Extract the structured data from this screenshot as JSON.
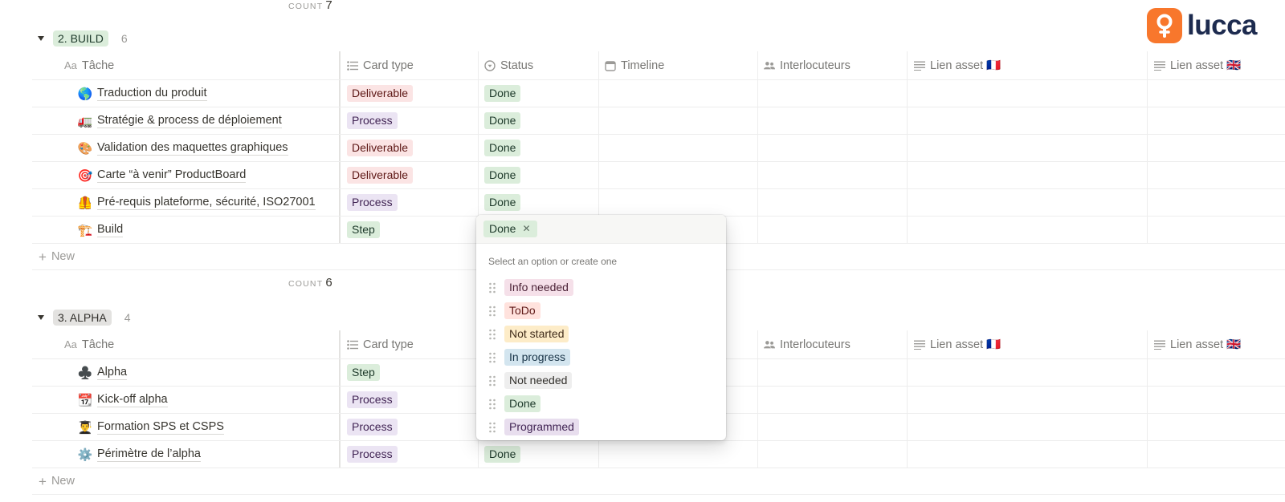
{
  "brand": {
    "name": "lucca",
    "accent": "#f8772c",
    "text_color": "#1d2b4f"
  },
  "top_count": {
    "label": "COUNT",
    "value": "7"
  },
  "columns": {
    "task": "Tâche",
    "task_prefix": "Aa",
    "card_type": "Card type",
    "status": "Status",
    "timeline": "Timeline",
    "contacts": "Interlocuteurs",
    "asset_fr": "Lien asset 🇫🇷",
    "asset_en": "Lien asset 🇬🇧"
  },
  "build": {
    "label": "2. BUILD",
    "count": "6",
    "color": "#dbeddb",
    "rows": [
      {
        "emoji": "🌎",
        "title": "Traduction du produit",
        "card_type": "Deliverable",
        "status": "Done"
      },
      {
        "emoji": "🚛",
        "title": "Stratégie & process de déploiement",
        "card_type": "Process",
        "status": "Done"
      },
      {
        "emoji": "🎨",
        "title": "Validation des maquettes graphiques",
        "card_type": "Deliverable",
        "status": "Done"
      },
      {
        "emoji": "🎯",
        "title": "Carte “à venir” ProductBoard",
        "card_type": "Deliverable",
        "status": "Done"
      },
      {
        "emoji": "🦺",
        "title": "Pré-requis plateforme, sécurité, ISO27001",
        "card_type": "Process",
        "status": "Done"
      },
      {
        "emoji": "🏗️",
        "title": "Build",
        "card_type": "Step",
        "status": ""
      }
    ],
    "new_label": "New",
    "count_label": "COUNT",
    "count_value": "6"
  },
  "alpha": {
    "label": "3. ALPHA",
    "count": "4",
    "color": "#e3e2e0",
    "rows": [
      {
        "emoji": "♣️",
        "title": "Alpha",
        "card_type": "Step",
        "status": ""
      },
      {
        "emoji": "📆",
        "title": "Kick-off alpha",
        "card_type": "Process",
        "status": ""
      },
      {
        "emoji": "👨‍🎓",
        "title": "Formation SPS et CSPS",
        "card_type": "Process",
        "status": ""
      },
      {
        "emoji": "⚙️",
        "title": "Périmètre de l’alpha",
        "card_type": "Process",
        "status": "Done"
      }
    ],
    "new_label": "New"
  },
  "dropdown": {
    "selected": "Done",
    "hint": "Select an option or create one",
    "options": [
      "Info needed",
      "ToDo",
      "Not started",
      "In progress",
      "Not needed",
      "Done",
      "Programmed"
    ]
  }
}
